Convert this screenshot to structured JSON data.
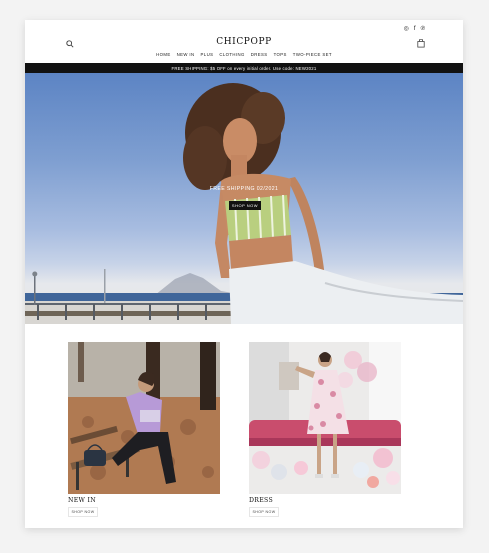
{
  "header": {
    "logo": "CHICPOPP",
    "social": [
      "instagram-icon",
      "facebook-icon",
      "pinterest-icon"
    ],
    "social_glyphs": [
      "◎",
      "f",
      "℗"
    ]
  },
  "nav": {
    "items": [
      "HOME",
      "NEW IN",
      "PLUS",
      "CLOTHING",
      "DRESS",
      "TOPS",
      "TWO-PIECE SET"
    ]
  },
  "promo": {
    "text": "FREE SHIPPING: $5 OFF on every initial order. Use code: NEW2021"
  },
  "hero": {
    "headline": "FREE SHIPPING 02/2021",
    "button": "SHOP NOW"
  },
  "collections": [
    {
      "title": "NEW IN",
      "button": "SHOP NOW"
    },
    {
      "title": "DRESS",
      "button": "SHOP NOW"
    }
  ],
  "colors": {
    "accent": "#111111",
    "background": "#ffffff"
  }
}
